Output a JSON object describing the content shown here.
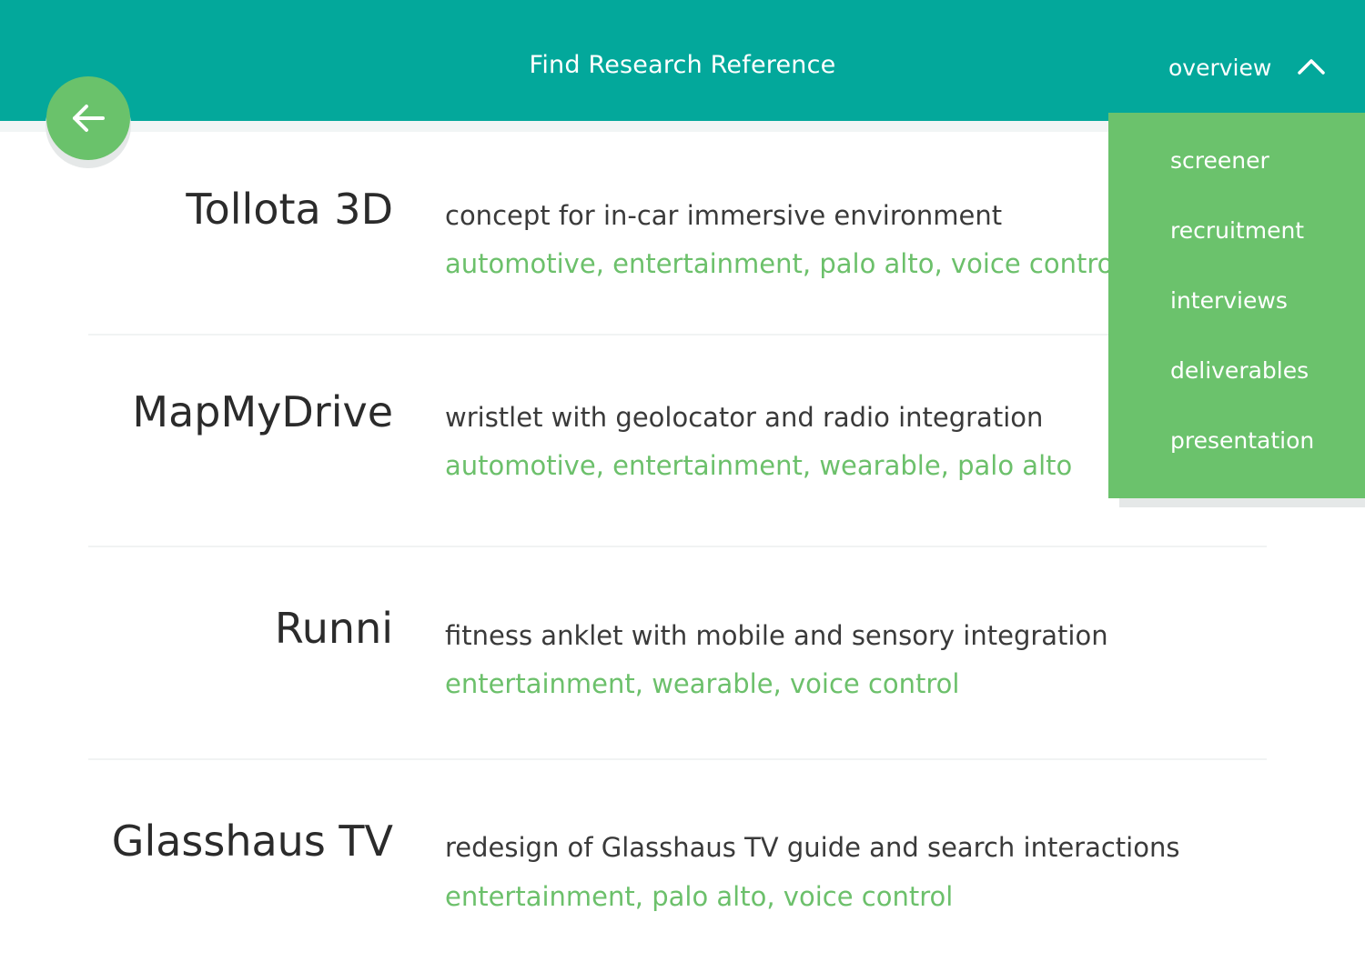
{
  "header": {
    "title": "Find Research Reference",
    "menu_label": "overview"
  },
  "icons": {
    "back": "arrow-left-icon",
    "menu_toggle": "chevron-up-icon"
  },
  "colors": {
    "header_bg": "#03a89b",
    "accent_green": "#6ac26b",
    "tag_text": "#6cc06b"
  },
  "menu": {
    "items": [
      "screener",
      "recruitment",
      "interviews",
      "deliverables",
      "presentation"
    ]
  },
  "projects": [
    {
      "name": "Tollota 3D",
      "description": "concept for in-car immersive environment",
      "tags": "automotive, entertainment, palo alto, voice control"
    },
    {
      "name": "MapMyDrive",
      "description": "wristlet with geolocator and radio integration",
      "tags": "automotive, entertainment, wearable, palo alto"
    },
    {
      "name": "Runni",
      "description": "fitness anklet with mobile and sensory integration",
      "tags": "entertainment, wearable, voice control"
    },
    {
      "name": "Glasshaus TV",
      "description": "redesign of Glasshaus TV guide and search interactions",
      "tags": "entertainment, palo alto, voice control"
    }
  ]
}
